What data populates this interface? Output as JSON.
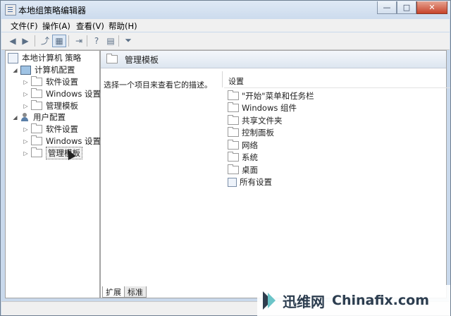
{
  "window": {
    "title": "本地组策略编辑器"
  },
  "menu": [
    "文件(F)",
    "操作(A)",
    "查看(V)",
    "帮助(H)"
  ],
  "toolbar": {
    "buttons": [
      "back-icon",
      "forward-icon",
      "up-icon",
      "show-tree-icon",
      "export-icon",
      "help-icon",
      "properties-icon",
      "filter-icon"
    ]
  },
  "tree": {
    "root": "本地计算机 策略",
    "computer": "计算机配置",
    "computer_children": [
      "软件设置",
      "Windows 设置",
      "管理模板"
    ],
    "user": "用户配置",
    "user_children": [
      "软件设置",
      "Windows 设置",
      "管理模板"
    ]
  },
  "right": {
    "header": "管理模板",
    "description": "选择一个项目来查看它的描述。",
    "column": "设置",
    "items": [
      "\"开始\"菜单和任务栏",
      "Windows 组件",
      "共享文件夹",
      "控制面板",
      "网络",
      "系统",
      "桌面",
      "所有设置"
    ]
  },
  "tabs": [
    "扩展",
    "标准"
  ],
  "watermark": {
    "brand_cn": "迅维网",
    "brand_en": "Chinafix.com"
  }
}
